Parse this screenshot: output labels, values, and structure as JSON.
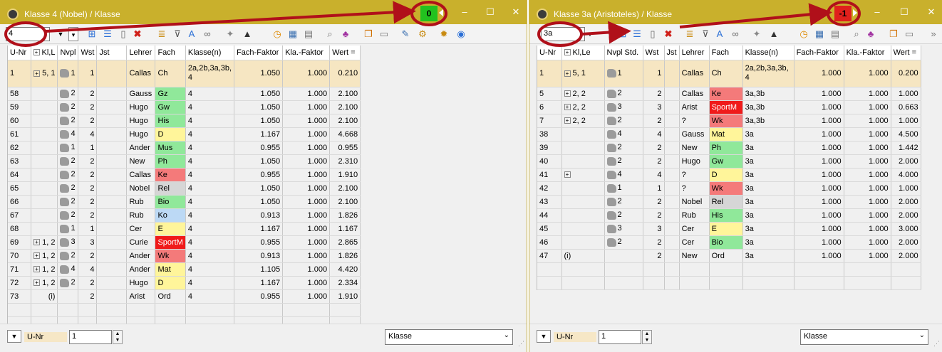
{
  "left": {
    "title": "Klasse 4 (Nobel) / Klasse",
    "counter": "0",
    "class_field": "4",
    "columns": [
      "U-Nr",
      "Kl,L",
      "Nvpl",
      "Wst",
      "Jst",
      "Lehrer",
      "Fach",
      "Klasse(n)",
      "Fach-Faktor",
      "Kla.-Faktor",
      "Wert ="
    ],
    "rows": [
      {
        "unr": "1",
        "kl": "5, 1",
        "nvpl": "1",
        "wst": "1",
        "jst": "",
        "lehrer": "Callas",
        "fach": "Ch",
        "fc": "green",
        "klasse": "2a,2b,3a,3b, 4",
        "ff": "1.050",
        "kf": "1.000",
        "wert": "0.210"
      },
      {
        "unr": "58",
        "kl": "",
        "nvpl": "2",
        "wst": "2",
        "jst": "",
        "lehrer": "Gauss",
        "fach": "Gz",
        "fc": "green",
        "klasse": "4",
        "ff": "1.050",
        "kf": "1.000",
        "wert": "2.100"
      },
      {
        "unr": "59",
        "kl": "",
        "nvpl": "2",
        "wst": "2",
        "jst": "",
        "lehrer": "Hugo",
        "fach": "Gw",
        "fc": "green",
        "klasse": "4",
        "ff": "1.050",
        "kf": "1.000",
        "wert": "2.100"
      },
      {
        "unr": "60",
        "kl": "",
        "nvpl": "2",
        "wst": "2",
        "jst": "",
        "lehrer": "Hugo",
        "fach": "His",
        "fc": "green",
        "klasse": "4",
        "ff": "1.050",
        "kf": "1.000",
        "wert": "2.100"
      },
      {
        "unr": "61",
        "kl": "",
        "nvpl": "4",
        "wst": "4",
        "jst": "",
        "lehrer": "Hugo",
        "fach": "D",
        "fc": "yellow",
        "klasse": "4",
        "ff": "1.167",
        "kf": "1.000",
        "wert": "4.668"
      },
      {
        "unr": "62",
        "kl": "",
        "nvpl": "1",
        "wst": "1",
        "jst": "",
        "lehrer": "Ander",
        "fach": "Mus",
        "fc": "green",
        "klasse": "4",
        "ff": "0.955",
        "kf": "1.000",
        "wert": "0.955"
      },
      {
        "unr": "63",
        "kl": "",
        "nvpl": "2",
        "wst": "2",
        "jst": "",
        "lehrer": "New",
        "fach": "Ph",
        "fc": "green",
        "klasse": "4",
        "ff": "1.050",
        "kf": "1.000",
        "wert": "2.310"
      },
      {
        "unr": "64",
        "kl": "",
        "nvpl": "2",
        "wst": "2",
        "jst": "",
        "lehrer": "Callas",
        "fach": "Ke",
        "fc": "red",
        "klasse": "4",
        "ff": "0.955",
        "kf": "1.000",
        "wert": "1.910"
      },
      {
        "unr": "65",
        "kl": "",
        "nvpl": "2",
        "wst": "2",
        "jst": "",
        "lehrer": "Nobel",
        "fach": "Rel",
        "fc": "gray",
        "klasse": "4",
        "ff": "1.050",
        "kf": "1.000",
        "wert": "2.100"
      },
      {
        "unr": "66",
        "kl": "",
        "nvpl": "2",
        "wst": "2",
        "jst": "",
        "lehrer": "Rub",
        "fach": "Bio",
        "fc": "green",
        "klasse": "4",
        "ff": "1.050",
        "kf": "1.000",
        "wert": "2.100"
      },
      {
        "unr": "67",
        "kl": "",
        "nvpl": "2",
        "wst": "2",
        "jst": "",
        "lehrer": "Rub",
        "fach": "Ko",
        "fc": "blue",
        "klasse": "4",
        "ff": "0.913",
        "kf": "1.000",
        "wert": "1.826"
      },
      {
        "unr": "68",
        "kl": "",
        "nvpl": "1",
        "wst": "1",
        "jst": "",
        "lehrer": "Cer",
        "fach": "E",
        "fc": "yellow",
        "klasse": "4",
        "ff": "1.167",
        "kf": "1.000",
        "wert": "1.167"
      },
      {
        "unr": "69",
        "kl": "1, 2",
        "nvpl": "3",
        "wst": "3",
        "jst": "",
        "lehrer": "Curie",
        "fach": "SportM",
        "fc": "brightred",
        "klasse": "4",
        "ff": "0.955",
        "kf": "1.000",
        "wert": "2.865"
      },
      {
        "unr": "70",
        "kl": "1, 2",
        "nvpl": "2",
        "wst": "2",
        "jst": "",
        "lehrer": "Ander",
        "fach": "Wk",
        "fc": "red",
        "klasse": "4",
        "ff": "0.913",
        "kf": "1.000",
        "wert": "1.826"
      },
      {
        "unr": "71",
        "kl": "1, 2",
        "nvpl": "4",
        "wst": "4",
        "jst": "",
        "lehrer": "Ander",
        "fach": "Mat",
        "fc": "yellow",
        "klasse": "4",
        "ff": "1.105",
        "kf": "1.000",
        "wert": "4.420"
      },
      {
        "unr": "72",
        "kl": "1, 2",
        "nvpl": "2",
        "wst": "2",
        "jst": "",
        "lehrer": "Hugo",
        "fach": "D",
        "fc": "yellow",
        "klasse": "4",
        "ff": "1.167",
        "kf": "1.000",
        "wert": "2.334"
      },
      {
        "unr": "73",
        "kl": "(i)",
        "nvpl": "",
        "wst": "2",
        "jst": "",
        "lehrer": "Arist",
        "fach": "Ord",
        "fc": "",
        "klasse": "4",
        "ff": "0.955",
        "kf": "1.000",
        "wert": "1.910"
      }
    ],
    "bottom": {
      "label": "U-Nr",
      "value": "1",
      "select": "Klasse"
    }
  },
  "right": {
    "title": "Klasse 3a (Aristoteles) / Klasse",
    "counter": "-1",
    "class_field": "3a",
    "columns": [
      "U-Nr",
      "Kl,Le",
      "Nvpl Std.",
      "Wst",
      "Jst",
      "Lehrer",
      "Fach",
      "Klasse(n)",
      "Fach-Faktor",
      "Kla.-Faktor",
      "Wert ="
    ],
    "rows": [
      {
        "unr": "1",
        "kl": "5, 1",
        "nvpl": "1",
        "wst": "1",
        "jst": "",
        "lehrer": "Callas",
        "fach": "Ch",
        "fc": "green",
        "klasse": "2a,2b,3a,3b, 4",
        "ff": "1.000",
        "kf": "1.000",
        "wert": "0.200"
      },
      {
        "unr": "5",
        "kl": "2, 2",
        "nvpl": "2",
        "wst": "2",
        "jst": "",
        "lehrer": "Callas",
        "fach": "Ke",
        "fc": "red",
        "klasse": "3a,3b",
        "ff": "1.000",
        "kf": "1.000",
        "wert": "1.000"
      },
      {
        "unr": "6",
        "kl": "2, 2",
        "nvpl": "3",
        "wst": "3",
        "jst": "",
        "lehrer": "Arist",
        "fach": "SportM",
        "fc": "brightred",
        "klasse": "3a,3b",
        "ff": "1.000",
        "kf": "1.000",
        "wert": "0.663"
      },
      {
        "unr": "7",
        "kl": "2, 2",
        "nvpl": "2",
        "wst": "2",
        "jst": "",
        "lehrer": "?",
        "fach": "Wk",
        "fc": "red",
        "klasse": "3a,3b",
        "ff": "1.000",
        "kf": "1.000",
        "wert": "1.000"
      },
      {
        "unr": "38",
        "kl": "",
        "nvpl": "4",
        "wst": "4",
        "jst": "",
        "lehrer": "Gauss",
        "fach": "Mat",
        "fc": "yellow",
        "klasse": "3a",
        "ff": "1.000",
        "kf": "1.000",
        "wert": "4.500"
      },
      {
        "unr": "39",
        "kl": "",
        "nvpl": "2",
        "wst": "2",
        "jst": "",
        "lehrer": "New",
        "fach": "Ph",
        "fc": "green",
        "klasse": "3a",
        "ff": "1.000",
        "kf": "1.000",
        "wert": "1.442"
      },
      {
        "unr": "40",
        "kl": "",
        "nvpl": "2",
        "wst": "2",
        "jst": "",
        "lehrer": "Hugo",
        "fach": "Gw",
        "fc": "green",
        "klasse": "3a",
        "ff": "1.000",
        "kf": "1.000",
        "wert": "2.000"
      },
      {
        "unr": "41",
        "kl": "+",
        "nvpl": "4",
        "wst": "4",
        "jst": "",
        "lehrer": "?",
        "fach": "D",
        "fc": "yellow",
        "klasse": "3a",
        "ff": "1.000",
        "kf": "1.000",
        "wert": "4.000"
      },
      {
        "unr": "42",
        "kl": "",
        "nvpl": "1",
        "wst": "1",
        "jst": "",
        "lehrer": "?",
        "fach": "Wk",
        "fc": "red",
        "klasse": "3a",
        "ff": "1.000",
        "kf": "1.000",
        "wert": "1.000"
      },
      {
        "unr": "43",
        "kl": "",
        "nvpl": "2",
        "wst": "2",
        "jst": "",
        "lehrer": "Nobel",
        "fach": "Rel",
        "fc": "gray",
        "klasse": "3a",
        "ff": "1.000",
        "kf": "1.000",
        "wert": "2.000"
      },
      {
        "unr": "44",
        "kl": "",
        "nvpl": "2",
        "wst": "2",
        "jst": "",
        "lehrer": "Rub",
        "fach": "His",
        "fc": "green",
        "klasse": "3a",
        "ff": "1.000",
        "kf": "1.000",
        "wert": "2.000"
      },
      {
        "unr": "45",
        "kl": "",
        "nvpl": "3",
        "wst": "3",
        "jst": "",
        "lehrer": "Cer",
        "fach": "E",
        "fc": "yellow",
        "klasse": "3a",
        "ff": "1.000",
        "kf": "1.000",
        "wert": "3.000"
      },
      {
        "unr": "46",
        "kl": "",
        "nvpl": "2",
        "wst": "2",
        "jst": "",
        "lehrer": "Cer",
        "fach": "Bio",
        "fc": "green",
        "klasse": "3a",
        "ff": "1.000",
        "kf": "1.000",
        "wert": "2.000"
      },
      {
        "unr": "47",
        "kl": "(i)",
        "nvpl": "",
        "wst": "2",
        "jst": "",
        "lehrer": "New",
        "fach": "Ord",
        "fc": "",
        "klasse": "3a",
        "ff": "1.000",
        "kf": "1.000",
        "wert": "2.000"
      }
    ],
    "bottom": {
      "label": "U-Nr",
      "value": "1",
      "select": "Klasse"
    }
  },
  "window_controls": {
    "minimize": "–",
    "maximize": "☐",
    "close": "✕"
  },
  "colors": {
    "titlebar": "#c9b02c",
    "selected_row": "#f6e6c2",
    "annotation": "#b0101a",
    "green": "#90e89a",
    "yellow": "#fff59a",
    "red": "#f47a7a"
  }
}
